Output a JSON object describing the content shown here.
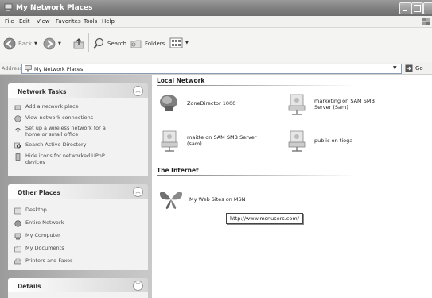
{
  "window": {
    "title": "My Network Places"
  },
  "menu": [
    "File",
    "Edit",
    "View",
    "Favorites",
    "Tools",
    "Help"
  ],
  "toolbar": {
    "back": "Back",
    "search": "Search",
    "folders": "Folders"
  },
  "address": {
    "label": "Address",
    "value": "My Network Places",
    "go": "Go"
  },
  "network_tasks": {
    "title": "Network Tasks",
    "items": [
      "Add a network place",
      "View network connections",
      "Set up a wireless network for a home or small office",
      "Search Active Directory",
      "Hide icons for networked UPnP devices"
    ]
  },
  "other_places": {
    "title": "Other Places",
    "items": [
      "Desktop",
      "Entire Network",
      "My Computer",
      "My Documents",
      "Printers and Faxes"
    ]
  },
  "details": {
    "title": "Details"
  },
  "local_network": {
    "title": "Local Network",
    "items": [
      "ZoneDirector 1000",
      "marketing on SAM SMB Server (Sam)",
      "maitte on SAM SMB Server (sam)",
      "public on tioga"
    ]
  },
  "internet": {
    "title": "The Internet",
    "items": [
      "My Web Sites on MSN"
    ],
    "tooltip": "http://www.msnusers.com/"
  }
}
